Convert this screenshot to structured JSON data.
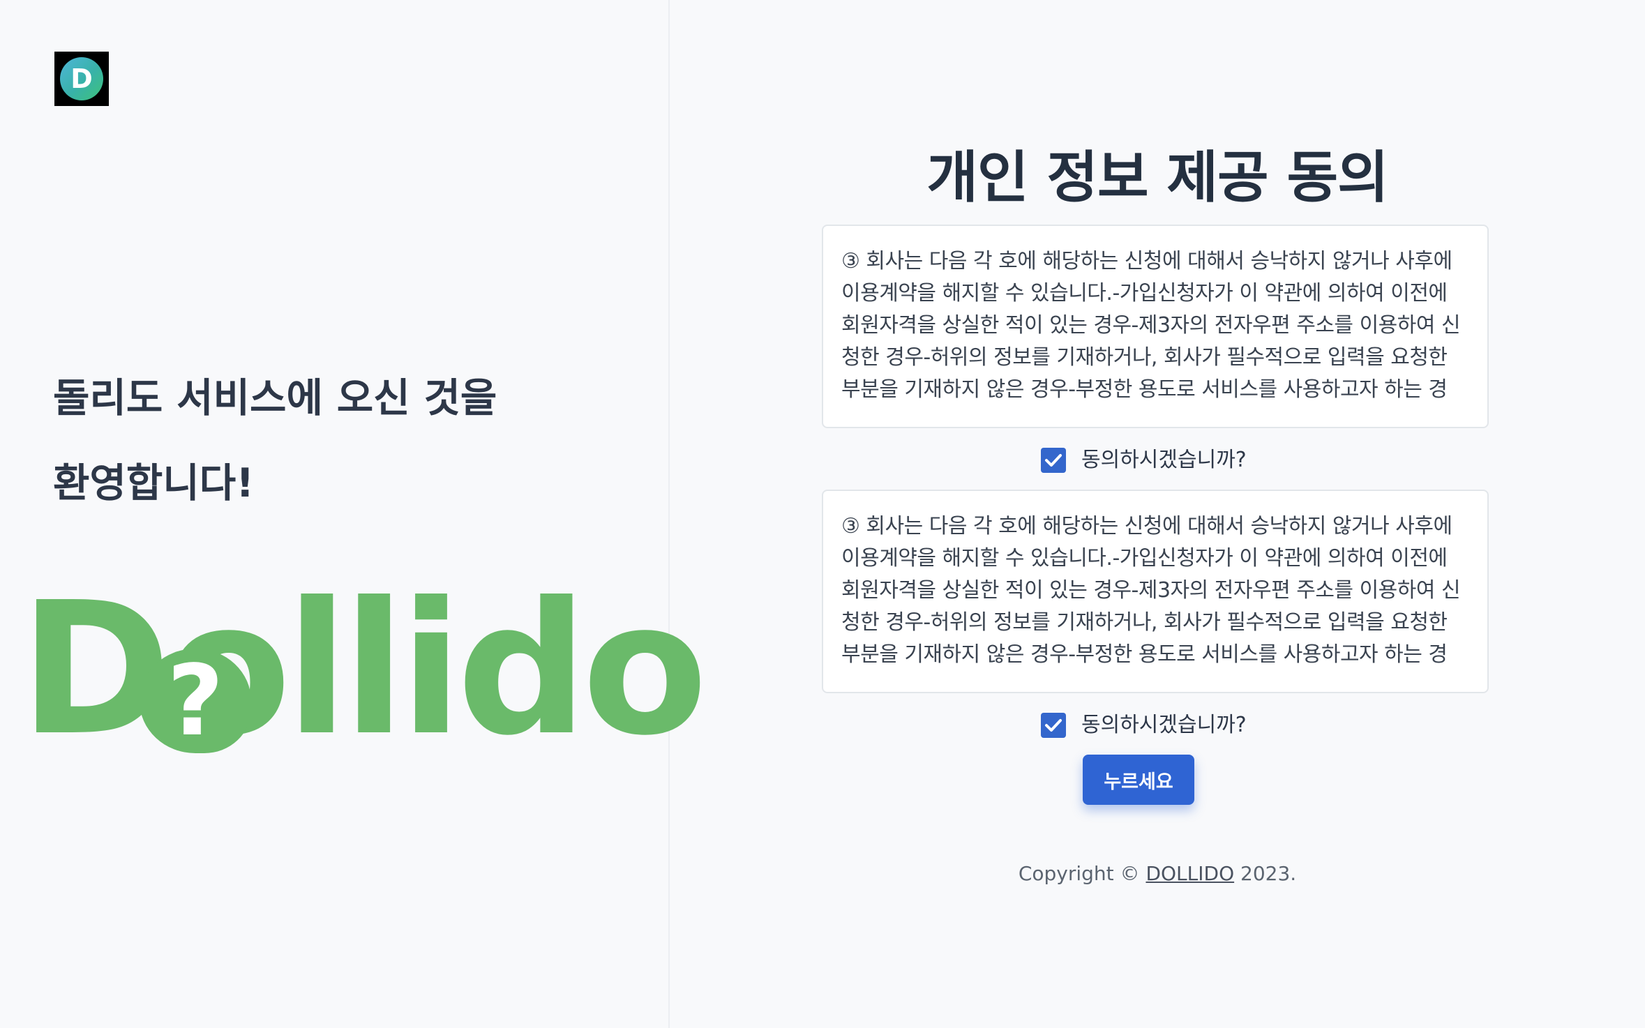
{
  "left": {
    "logo_letter": "D",
    "welcome_line1": "돌리도 서비스에 오신 것을",
    "welcome_line2": "환영합니다!",
    "brand_word": "Dollido",
    "brand_bubble_symbol": "?"
  },
  "right": {
    "title": "개인 정보 제공 동의",
    "terms": [
      {
        "text": "③ 회사는 다음 각 호에 해당하는 신청에 대해서 승낙하지 않거나 사후에 이용계약을 해지할 수 있습니다.-가입신청자가 이 약관에 의하여 이전에 회원자격을 상실한 적이 있는 경우-제3자의 전자우편 주소를 이용하여 신청한 경우-허위의 정보를 기재하거나, 회사가 필수적으로 입력을 요청한 부분을 기재하지 않은 경우-부정한 용도로 서비스를 사용하고자 하는 경",
        "agree_label": "동의하시겠습니까?",
        "checked": true
      },
      {
        "text": "③ 회사는 다음 각 호에 해당하는 신청에 대해서 승낙하지 않거나 사후에 이용계약을 해지할 수 있습니다.-가입신청자가 이 약관에 의하여 이전에 회원자격을 상실한 적이 있는 경우-제3자의 전자우편 주소를 이용하여 신청한 경우-허위의 정보를 기재하거나, 회사가 필수적으로 입력을 요청한 부분을 기재하지 않은 경우-부정한 용도로 서비스를 사용하고자 하는 경",
        "agree_label": "동의하시겠습니까?",
        "checked": true
      }
    ],
    "submit_label": "누르세요",
    "copyright_prefix": "Copyright © ",
    "copyright_link": "DOLLIDO",
    "copyright_suffix": " 2023."
  },
  "colors": {
    "accent": "#2f64d3",
    "brand_green": "#6aba6a",
    "background": "#f8f9fb"
  }
}
